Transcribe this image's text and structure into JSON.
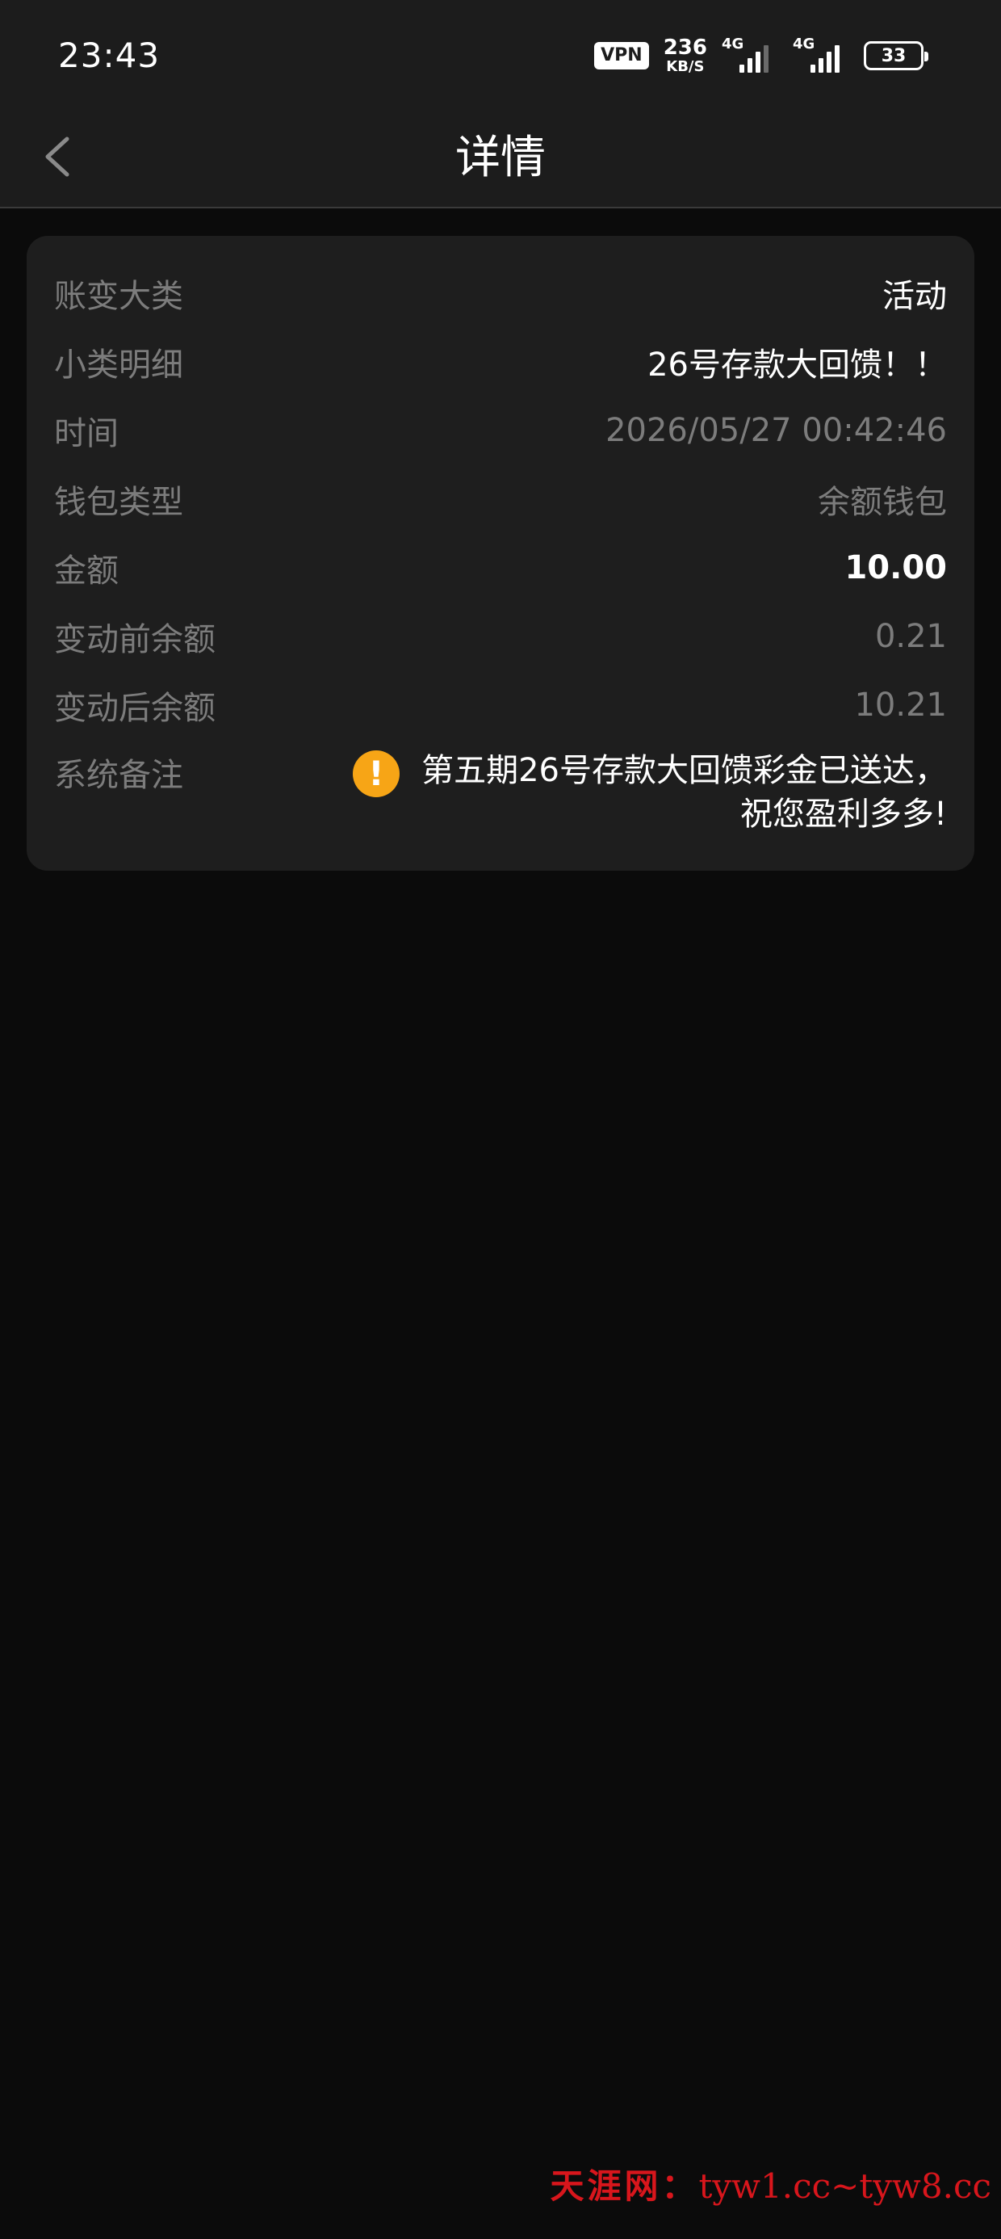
{
  "status_bar": {
    "time": "23:43",
    "vpn": "VPN",
    "net_speed_value": "236",
    "net_speed_unit": "KB/S",
    "signal1_tag": "4G",
    "signal2_tag": "4G",
    "battery": "33",
    "icons": [
      "vpn-icon",
      "signal-icon",
      "signal-icon",
      "battery-icon"
    ]
  },
  "header": {
    "title": "详情",
    "back_icon": "chevron-left-icon"
  },
  "details": {
    "category": {
      "label": "账变大类",
      "value": "活动"
    },
    "subcategory": {
      "label": "小类明细",
      "value": "26号存款大回馈！！"
    },
    "time": {
      "label": "时间",
      "value": "2026/05/27 00:42:46"
    },
    "wallet_type": {
      "label": "钱包类型",
      "value": "余额钱包"
    },
    "amount": {
      "label": "金额",
      "value": "10.00"
    },
    "balance_before": {
      "label": "变动前余额",
      "value": "0.21"
    },
    "balance_after": {
      "label": "变动后余额",
      "value": "10.21"
    },
    "system_note": {
      "label": "系统备注",
      "value": "第五期26号存款大回馈彩金已送达，祝您盈利多多!",
      "icon": "warning-icon"
    }
  },
  "watermark": {
    "name": "天涯网：",
    "domains": "tyw1.cc~tyw8.cc"
  },
  "colors": {
    "background": "#0b0b0b",
    "bar": "#1c1c1c",
    "card": "#1e1e1e",
    "label": "#7c7c7c",
    "warning": "#f7a516",
    "watermark": "#d8161c"
  }
}
